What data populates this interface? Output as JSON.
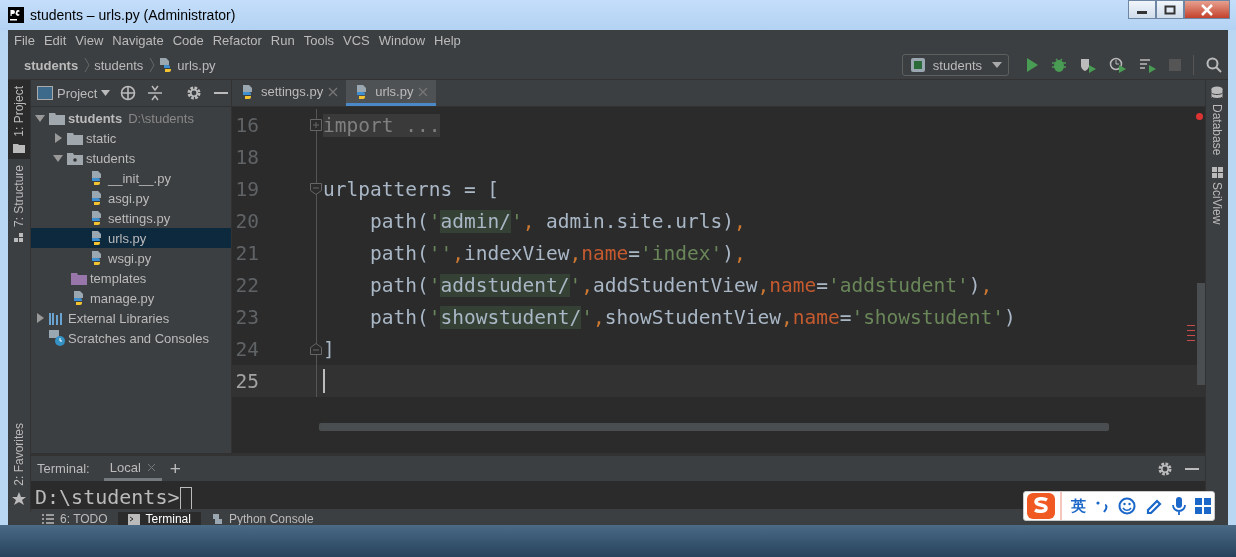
{
  "window": {
    "title": "students – urls.py (Administrator)"
  },
  "menu": [
    "File",
    "Edit",
    "View",
    "Navigate",
    "Code",
    "Refactor",
    "Run",
    "Tools",
    "VCS",
    "Window",
    "Help"
  ],
  "breadcrumbs": [
    {
      "label": "students",
      "kind": "project"
    },
    {
      "label": "students",
      "kind": "folder"
    },
    {
      "label": "urls.py",
      "kind": "file"
    }
  ],
  "run_config": {
    "label": "students"
  },
  "left_strip": [
    {
      "label": "1: Project",
      "selected": true,
      "kind": "folder"
    },
    {
      "label": "7: Structure",
      "selected": false,
      "kind": "structure"
    },
    {
      "label": "2: Favorites",
      "selected": false,
      "kind": "star"
    }
  ],
  "right_strip": [
    {
      "label": "Database",
      "kind": "database"
    },
    {
      "label": "SciView",
      "kind": "grid"
    }
  ],
  "project": {
    "title": "Project",
    "tree": [
      {
        "label": "students",
        "hint": "D:\\students",
        "kind": "folder",
        "expanded": true,
        "selected": false,
        "children": [
          {
            "label": "static",
            "kind": "folder",
            "expanded": false,
            "selected": false
          },
          {
            "label": "students",
            "kind": "package",
            "expanded": true,
            "selected": false,
            "children": [
              {
                "label": "__init__.py",
                "kind": "python",
                "selected": false
              },
              {
                "label": "asgi.py",
                "kind": "python",
                "selected": false
              },
              {
                "label": "settings.py",
                "kind": "python",
                "selected": false
              },
              {
                "label": "urls.py",
                "kind": "python",
                "selected": true
              },
              {
                "label": "wsgi.py",
                "kind": "python",
                "selected": false
              }
            ]
          },
          {
            "label": "templates",
            "kind": "templates",
            "selected": false
          },
          {
            "label": "manage.py",
            "kind": "python",
            "selected": false
          }
        ]
      },
      {
        "label": "External Libraries",
        "kind": "libraries",
        "expanded": false,
        "selected": false
      },
      {
        "label": "Scratches and Consoles",
        "kind": "scratches",
        "selected": false
      }
    ]
  },
  "tabs": [
    {
      "label": "settings.py",
      "selected": false
    },
    {
      "label": "urls.py",
      "selected": true
    }
  ],
  "editor": {
    "lines": [
      {
        "number": "16",
        "current": false,
        "kind": "folded",
        "tokens": [
          {
            "kind": "folded",
            "text": "import ..."
          }
        ]
      },
      {
        "number": "18",
        "current": false,
        "kind": "code"
      },
      {
        "number": "19",
        "current": false,
        "kind": "block-start",
        "tokens": [
          {
            "kind": "plain",
            "text": "urlpatterns = ["
          }
        ]
      },
      {
        "number": "20",
        "current": false,
        "kind": "code",
        "tokens": [
          {
            "kind": "plain",
            "text": "    path("
          },
          {
            "kind": "string",
            "text": "'"
          },
          {
            "kind": "url",
            "text": "admin/"
          },
          {
            "kind": "string",
            "text": "'"
          },
          {
            "kind": "keyword",
            "text": ","
          },
          {
            "kind": "plain",
            "text": " admin.site.urls)"
          },
          {
            "kind": "keyword",
            "text": ","
          }
        ]
      },
      {
        "number": "21",
        "current": false,
        "kind": "code",
        "tokens": [
          {
            "kind": "plain",
            "text": "    path("
          },
          {
            "kind": "string",
            "text": "''"
          },
          {
            "kind": "keyword",
            "text": ","
          },
          {
            "kind": "plain",
            "text": "indexView"
          },
          {
            "kind": "keyword",
            "text": ","
          },
          {
            "kind": "param",
            "text": "name"
          },
          {
            "kind": "plain",
            "text": "="
          },
          {
            "kind": "string",
            "text": "'index'"
          },
          {
            "kind": "plain",
            "text": ")"
          },
          {
            "kind": "keyword",
            "text": ","
          }
        ]
      },
      {
        "number": "22",
        "current": false,
        "kind": "code",
        "tokens": [
          {
            "kind": "plain",
            "text": "    path("
          },
          {
            "kind": "string",
            "text": "'"
          },
          {
            "kind": "url",
            "text": "addstudent/"
          },
          {
            "kind": "string",
            "text": "'"
          },
          {
            "kind": "keyword",
            "text": ","
          },
          {
            "kind": "plain",
            "text": "addStudentView"
          },
          {
            "kind": "keyword",
            "text": ","
          },
          {
            "kind": "param",
            "text": "name"
          },
          {
            "kind": "plain",
            "text": "="
          },
          {
            "kind": "string",
            "text": "'addstudent'"
          },
          {
            "kind": "plain",
            "text": ")"
          },
          {
            "kind": "keyword",
            "text": ","
          }
        ]
      },
      {
        "number": "23",
        "current": false,
        "kind": "code",
        "tokens": [
          {
            "kind": "plain",
            "text": "    path("
          },
          {
            "kind": "string",
            "text": "'"
          },
          {
            "kind": "url",
            "text": "showstudent/"
          },
          {
            "kind": "string",
            "text": "'"
          },
          {
            "kind": "keyword",
            "text": ","
          },
          {
            "kind": "plain",
            "text": "showStudentView"
          },
          {
            "kind": "keyword",
            "text": ","
          },
          {
            "kind": "param",
            "text": "name"
          },
          {
            "kind": "plain",
            "text": "="
          },
          {
            "kind": "string",
            "text": "'showstudent'"
          },
          {
            "kind": "plain",
            "text": ")"
          }
        ]
      },
      {
        "number": "24",
        "current": false,
        "kind": "block-end",
        "tokens": [
          {
            "kind": "plain",
            "text": "]"
          }
        ]
      },
      {
        "number": "25",
        "current": true,
        "kind": "code"
      }
    ]
  },
  "terminal": {
    "label": "Terminal:",
    "tabs": [
      {
        "label": "Local",
        "selected": true
      }
    ],
    "add": "+",
    "prompt": "D:\\students>"
  },
  "bottom_tabs": [
    {
      "label": "6: TODO",
      "kind": "list",
      "selected": false
    },
    {
      "label": "Terminal",
      "kind": "terminal",
      "selected": true
    },
    {
      "label": "Python Console",
      "kind": "python",
      "selected": false
    }
  ],
  "ime": {
    "language": "英"
  }
}
